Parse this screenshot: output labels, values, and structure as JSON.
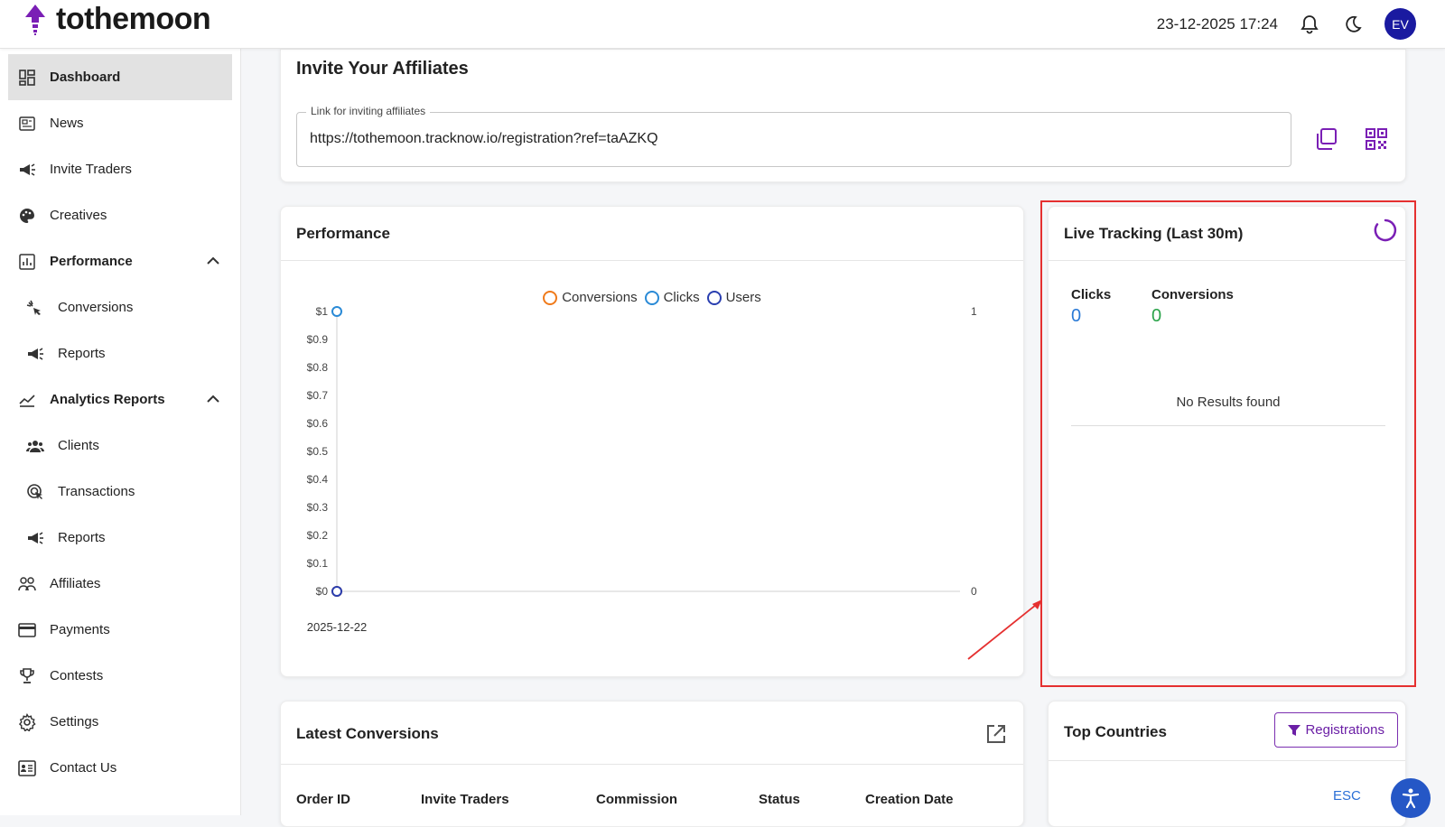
{
  "app": {
    "logo_text": "tothemoon",
    "datetime": "23-12-2025 17:24",
    "avatar_initials": "EV",
    "accent": "#6b1fa6"
  },
  "sidebar": {
    "items": [
      {
        "label": "Dashboard",
        "icon": "dashboard-icon"
      },
      {
        "label": "News",
        "icon": "news-icon"
      },
      {
        "label": "Invite Traders",
        "icon": "megaphone-icon"
      },
      {
        "label": "Creatives",
        "icon": "palette-icon"
      },
      {
        "label": "Performance",
        "icon": "bar-chart-icon"
      },
      {
        "label": "Conversions",
        "icon": "conversions-icon"
      },
      {
        "label": "Reports",
        "icon": "megaphone-icon"
      },
      {
        "label": "Analytics Reports",
        "icon": "line-chart-icon"
      },
      {
        "label": "Clients",
        "icon": "clients-icon"
      },
      {
        "label": "Transactions",
        "icon": "transactions-icon"
      },
      {
        "label": "Reports",
        "icon": "megaphone-icon"
      },
      {
        "label": "Affiliates",
        "icon": "affiliates-icon"
      },
      {
        "label": "Payments",
        "icon": "credit-card-icon"
      },
      {
        "label": "Contests",
        "icon": "trophy-icon"
      },
      {
        "label": "Settings",
        "icon": "gear-icon"
      },
      {
        "label": "Contact Us",
        "icon": "contact-icon"
      }
    ]
  },
  "invite": {
    "title": "Invite Your Affiliates",
    "field_label": "Link for inviting affiliates",
    "link": "https://tothemoon.tracknow.io/registration?ref=taAZKQ"
  },
  "performance": {
    "title": "Performance"
  },
  "chart_data": {
    "type": "line",
    "legend": [
      "Conversions",
      "Clicks",
      "Users"
    ],
    "legend_colors": [
      "#f07a1a",
      "#2a8ad6",
      "#2a3fb0"
    ],
    "categories": [
      "2025-12-22"
    ],
    "series": [
      {
        "name": "Conversions",
        "values": [
          0
        ]
      },
      {
        "name": "Clicks",
        "values": [
          1
        ]
      },
      {
        "name": "Users",
        "values": [
          0
        ]
      }
    ],
    "left_axis_ticks": [
      "$0",
      "$0.1",
      "$0.2",
      "$0.3",
      "$0.4",
      "$0.5",
      "$0.6",
      "$0.7",
      "$0.8",
      "$0.9",
      "$1"
    ],
    "right_axis_ticks": [
      "0",
      "1"
    ],
    "ylim": [
      0,
      1
    ]
  },
  "live": {
    "title": "Live Tracking (Last 30m)",
    "clicks_label": "Clicks",
    "clicks_value": "0",
    "conversions_label": "Conversions",
    "conversions_value": "0",
    "empty_text": "No Results found"
  },
  "latest": {
    "title": "Latest Conversions",
    "columns": [
      "Order ID",
      "Invite Traders",
      "Commission",
      "Status",
      "Creation Date"
    ]
  },
  "countries": {
    "title": "Top Countries",
    "filter_button": "Registrations"
  },
  "misc": {
    "esc_label": "ESC"
  }
}
